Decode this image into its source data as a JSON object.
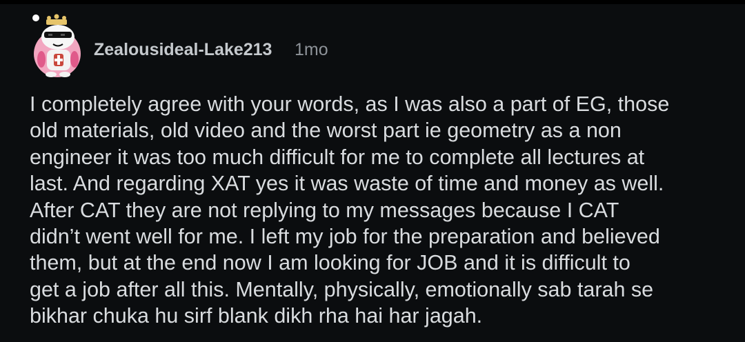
{
  "comment": {
    "author": "Zealousideal-Lake213",
    "age": "1mo",
    "body_lines": [
      "I completely agree with your words, as I was also a part of EG, those",
      "old materials, old video and the worst part ie geometry as a non",
      "engineer it was too much difficult for me to complete all lectures at",
      "last. And regarding XAT yes it was waste of time and money as well.",
      "After CAT they are not replying to my messages because I CAT",
      "didn’t went well for me. I left my job for the preparation and believed",
      "them, but at the end now I am looking for JOB and it is difficult to",
      "get a job after all this. Mentally, physically, emotionally sab tarah se",
      "bikhar chuka hu sirf blank dikh rha hai har jagah."
    ]
  },
  "colors": {
    "background": "#0b0d0f",
    "text": "#d9dcdf",
    "username": "#c5c9cd",
    "meta": "#8e9399"
  },
  "avatar_icon": "snoo-avatar-icon"
}
